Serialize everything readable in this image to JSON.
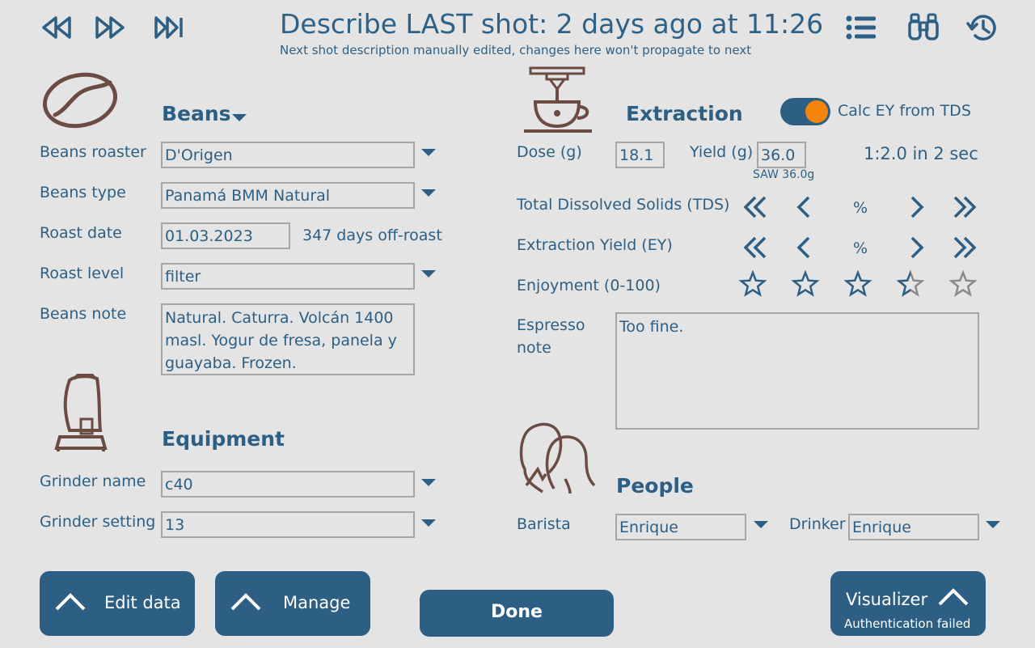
{
  "header": {
    "title": "Describe LAST shot: 2 days ago at 11:26",
    "subtitle": "Next shot description manually edited, changes here won't propagate to next"
  },
  "nav": {
    "first": "rewind-icon",
    "next": "fast-forward-icon",
    "last": "skip-to-end-icon"
  },
  "tools": {
    "list": "list-icon",
    "find": "binoculars-icon",
    "history": "history-icon"
  },
  "beans": {
    "title": "Beans",
    "roaster_label": "Beans roaster",
    "roaster": "D'Origen",
    "type_label": "Beans type",
    "type": "Panamá BMM Natural",
    "roast_date_label": "Roast date",
    "roast_date": "01.03.2023",
    "days_off_roast": "347 days off-roast",
    "roast_level_label": "Roast level",
    "roast_level": "filter",
    "note_label": "Beans note",
    "note": "Natural. Caturra. Volcán 1400 masl. Yogur de  fresa, panela y guayaba. Frozen."
  },
  "equipment": {
    "title": "Equipment",
    "grinder_name_label": "Grinder name",
    "grinder_name": "c40",
    "grinder_setting_label": "Grinder setting",
    "grinder_setting": "13"
  },
  "extraction": {
    "title": "Extraction",
    "calc_ey_label": "Calc EY from TDS",
    "calc_ey_on": true,
    "dose_label": "Dose (g)",
    "dose": "18.1",
    "yield_label": "Yield (g)",
    "yield": "36.0",
    "saw": "SAW 36.0g",
    "ratio": "1:2.0 in 2 sec",
    "tds_label": "Total Dissolved Solids (TDS)",
    "tds_unit": "%",
    "ey_label": "Extraction Yield (EY)",
    "ey_unit": "%",
    "enjoyment_label": "Enjoyment (0-100)",
    "enjoyment_stars_filled": 3.5,
    "espresso_note_label": "Espresso note",
    "espresso_note": "Too fine."
  },
  "people": {
    "title": "People",
    "barista_label": "Barista",
    "barista": "Enrique",
    "drinker_label": "Drinker",
    "drinker": "Enrique"
  },
  "buttons": {
    "edit_data": "Edit data",
    "manage": "Manage",
    "done": "Done",
    "visualizer": "Visualizer",
    "visualizer_status": "Authentication failed"
  },
  "colors": {
    "accent": "#2d5f84",
    "toggle_knob": "#f5840c",
    "icon_brown": "#6b4c43",
    "background": "#e4e4e4"
  }
}
